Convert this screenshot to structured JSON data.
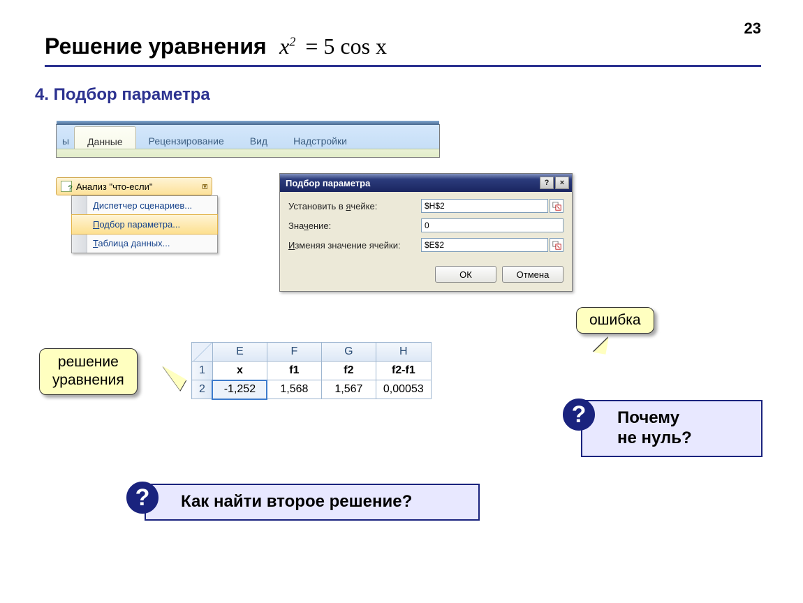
{
  "page_number": "23",
  "title": "Решение уравнения",
  "equation_lhs_var": "x",
  "equation_lhs_exp": "2",
  "equation_rhs": "= 5 cos x",
  "subtitle": "4. Подбор параметра",
  "ribbon": {
    "frag": "ы",
    "active": "Данные",
    "tabs": [
      "Рецензирование",
      "Вид",
      "Надстройки"
    ]
  },
  "whatif_button": "Анализ \"что-если\"",
  "whatif_menu": {
    "item1_pre": "Д",
    "item1_post": "испетчер сценариев...",
    "item2_pre": "П",
    "item2_post": "одбор параметра...",
    "item3_pre": "Т",
    "item3_post": "аблица данных..."
  },
  "dialog": {
    "title": "Подбор параметра",
    "row1_pre": "Установить в ",
    "row1_u": "я",
    "row1_post": "чейке:",
    "row1_value": "$H$2",
    "row2_pre": "Зна",
    "row2_u": "ч",
    "row2_post": "ение:",
    "row2_value": "0",
    "row3_pre": "",
    "row3_u": "И",
    "row3_post": "зменяя значение ячейки:",
    "row3_value": "$E$2",
    "ok": "ОК",
    "cancel": "Отмена",
    "help_btn": "?",
    "close_btn": "×"
  },
  "callout_solution_line1": "решение",
  "callout_solution_line2": "уравнения",
  "callout_error": "ошибка",
  "table": {
    "cols": [
      "E",
      "F",
      "G",
      "H"
    ],
    "rows": [
      "1",
      "2"
    ],
    "header": [
      "x",
      "f1",
      "f2",
      "f2-f1"
    ],
    "values": [
      "-1,252",
      "1,568",
      "1,567",
      "0,00053"
    ]
  },
  "question_why_line1": "Почему",
  "question_why_line2": "не нуль?",
  "question_how": "Как найти второе решение?",
  "qmark": "?"
}
